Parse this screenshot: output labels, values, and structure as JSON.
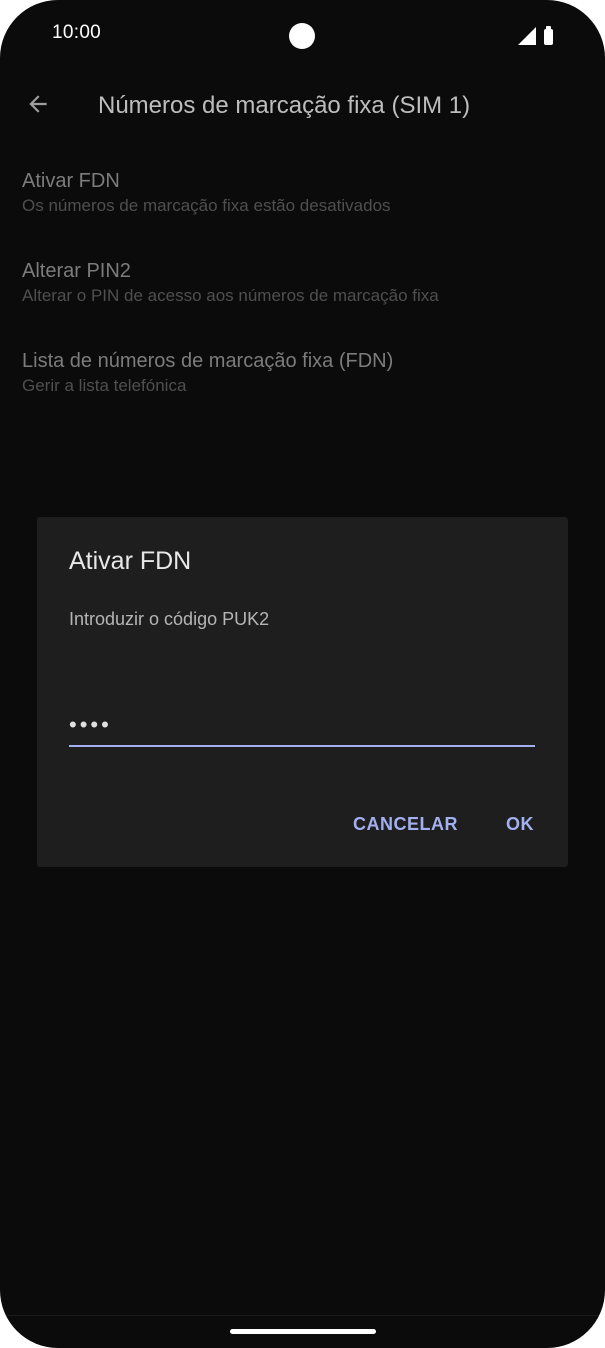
{
  "status_bar": {
    "time": "10:00",
    "icons": [
      "signal-icon",
      "battery-icon"
    ]
  },
  "toolbar": {
    "back_icon": "arrow-back-icon",
    "title": "Números de marcação fixa (SIM 1)"
  },
  "settings": {
    "items": [
      {
        "title": "Ativar FDN",
        "summary": "Os números de marcação fixa estão desativados"
      },
      {
        "title": "Alterar PIN2",
        "summary": "Alterar o PIN de acesso aos números de marcação fixa"
      },
      {
        "title": "Lista de números de marcação fixa (FDN)",
        "summary": "Gerir a lista telefónica"
      }
    ]
  },
  "dialog": {
    "title": "Ativar FDN",
    "message": "Introduzir o código PUK2",
    "input_value": "••••",
    "cancel_label": "CANCELAR",
    "ok_label": "OK"
  },
  "colors": {
    "background": "#0b0b0b",
    "dialog_background": "#1e1e1e",
    "accent": "#a3b0f0"
  }
}
